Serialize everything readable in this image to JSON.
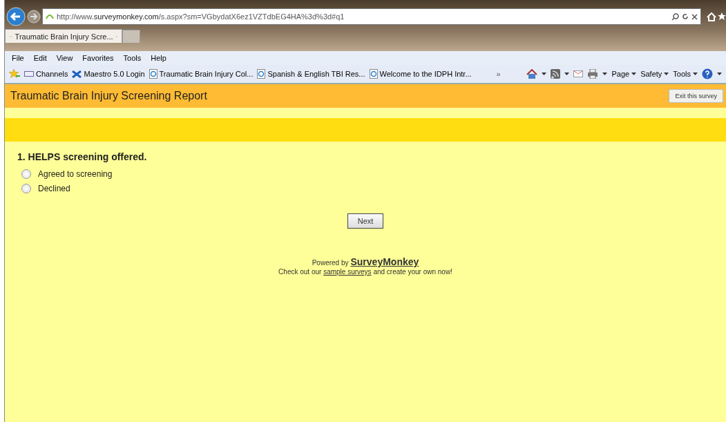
{
  "browser": {
    "address": "http://www.**surveymonkey.com**/s.aspx?sm=VGbydatX6ez1VZTdbEG4HA%3d%3d#q1",
    "tabs": [
      {
        "label": "Traumatic Brain Injury Scre...",
        "selected": true
      }
    ],
    "menu": [
      "File",
      "Edit",
      "View",
      "Favorites",
      "Tools",
      "Help"
    ],
    "favorites": [
      {
        "kind": "feed",
        "label": "Channels"
      },
      {
        "kind": "x",
        "label": "Maestro 5.0 Login"
      },
      {
        "kind": "ie",
        "label": "Traumatic Brain Injury Col..."
      },
      {
        "kind": "ie",
        "label": "Spanish & English TBI Res..."
      },
      {
        "kind": "ie",
        "label": "Welcome to the IDPH Intr..."
      }
    ],
    "more": "»",
    "commands": [
      "Page",
      "Safety",
      "Tools"
    ]
  },
  "survey": {
    "title": "Traumatic Brain Injury Screening Report",
    "exit": "Exit this survey",
    "question": "1. HELPS screening offered.",
    "options": [
      {
        "label": "Agreed to screening",
        "selected": false
      },
      {
        "label": "Declined",
        "selected": false
      }
    ],
    "next": "Next",
    "powered_by": "Powered by",
    "brand": "SurveyMonkey",
    "footer": {
      "before": "Check out our ",
      "link": "sample surveys",
      "after": " and create your own now!"
    }
  }
}
